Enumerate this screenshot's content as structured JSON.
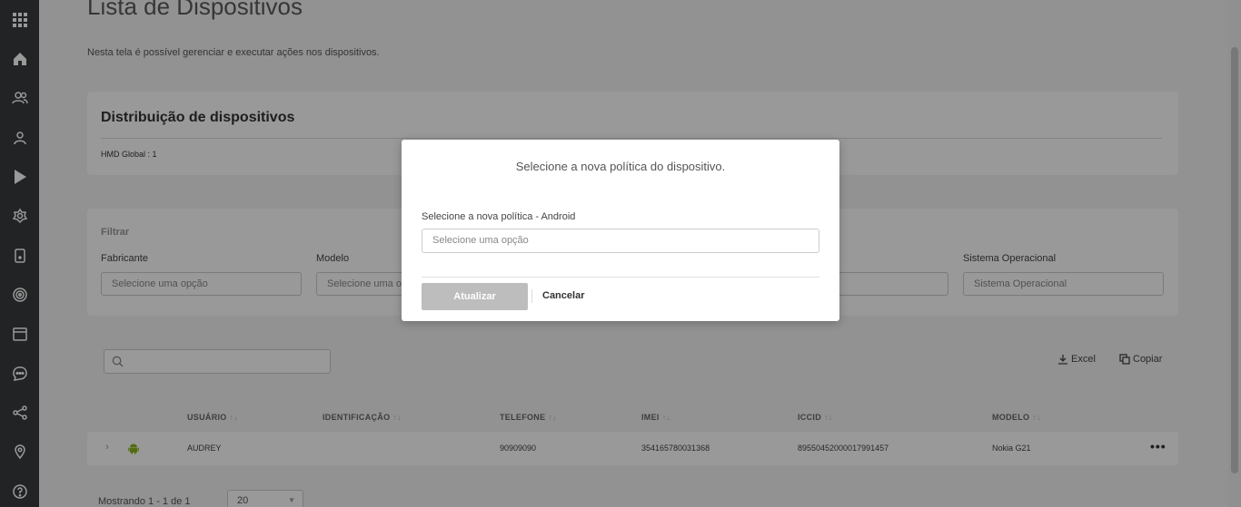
{
  "page": {
    "title": "Lista de Dispositivos",
    "subtitle": "Nesta tela é possível gerenciar e executar ações nos dispositivos."
  },
  "distribution": {
    "title": "Distribuição de dispositivos",
    "info": "HMD Global : 1"
  },
  "filter": {
    "title": "Filtrar",
    "fields": [
      {
        "label": "Fabricante",
        "placeholder": "Selecione uma opção"
      },
      {
        "label": "Modelo",
        "placeholder": "Selecione uma opção"
      },
      {
        "label": "Sistema Operacional",
        "placeholder": "Sistema Operacional"
      }
    ]
  },
  "toolbar": {
    "excel": "Excel",
    "copy": "Copiar"
  },
  "table": {
    "headers": [
      "USUÁRIO",
      "IDENTIFICAÇÃO",
      "TELEFONE",
      "IMEI",
      "ICCID",
      "MODELO"
    ],
    "rows": [
      {
        "usuario": "AUDREY",
        "identificacao": "",
        "telefone": "90909090",
        "imei": "354165780031368",
        "iccid": "89550452000017991457",
        "modelo": "Nokia G21"
      }
    ]
  },
  "footer": {
    "showing": "Mostrando 1 - 1 de 1",
    "page_size": "20"
  },
  "modal": {
    "title": "Selecione a nova política do dispositivo.",
    "field_label": "Selecione a nova política - Android",
    "field_placeholder": "Selecione uma opção",
    "update_label": "Atualizar",
    "cancel_label": "Cancelar"
  },
  "sidebar": {
    "icons": [
      "apps-grid-icon",
      "home-icon",
      "users-icon",
      "user-icon",
      "play-store-icon",
      "settings-flower-icon",
      "device-icon",
      "fingerprint-icon",
      "calendar-icon",
      "chat-icon",
      "share-icon",
      "location-pin-icon",
      "help-icon"
    ]
  },
  "colors": {
    "sidebar": "#3a3b3d",
    "android_green": "#8ab41a",
    "update_button": "#bdbdbd"
  }
}
